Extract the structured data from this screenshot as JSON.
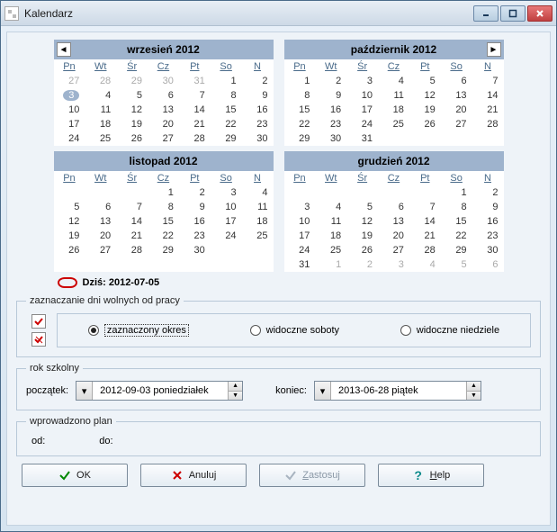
{
  "window": {
    "title": "Kalendarz"
  },
  "nav": {
    "prev": "◄",
    "next": "►"
  },
  "weekdays": [
    "Pn",
    "Wt",
    "Śr",
    "Cz",
    "Pt",
    "So",
    "N"
  ],
  "months": [
    {
      "label": "wrzesień  2012",
      "nav": "prev",
      "selected_row": 1,
      "selected_col": 0,
      "grid": [
        [
          {
            "d": 27,
            "dim": true
          },
          {
            "d": 28,
            "dim": true
          },
          {
            "d": 29,
            "dim": true
          },
          {
            "d": 30,
            "dim": true
          },
          {
            "d": 31,
            "dim": true
          },
          {
            "d": 1
          },
          {
            "d": 2
          }
        ],
        [
          {
            "d": 3
          },
          {
            "d": 4
          },
          {
            "d": 5
          },
          {
            "d": 6
          },
          {
            "d": 7
          },
          {
            "d": 8
          },
          {
            "d": 9
          }
        ],
        [
          {
            "d": 10
          },
          {
            "d": 11
          },
          {
            "d": 12
          },
          {
            "d": 13
          },
          {
            "d": 14
          },
          {
            "d": 15
          },
          {
            "d": 16
          }
        ],
        [
          {
            "d": 17
          },
          {
            "d": 18
          },
          {
            "d": 19
          },
          {
            "d": 20
          },
          {
            "d": 21
          },
          {
            "d": 22
          },
          {
            "d": 23
          }
        ],
        [
          {
            "d": 24
          },
          {
            "d": 25
          },
          {
            "d": 26
          },
          {
            "d": 27
          },
          {
            "d": 28
          },
          {
            "d": 29
          },
          {
            "d": 30
          }
        ]
      ]
    },
    {
      "label": "październik  2012",
      "nav": "next",
      "grid": [
        [
          {
            "d": 1
          },
          {
            "d": 2
          },
          {
            "d": 3
          },
          {
            "d": 4
          },
          {
            "d": 5
          },
          {
            "d": 6
          },
          {
            "d": 7
          }
        ],
        [
          {
            "d": 8
          },
          {
            "d": 9
          },
          {
            "d": 10
          },
          {
            "d": 11
          },
          {
            "d": 12
          },
          {
            "d": 13
          },
          {
            "d": 14
          }
        ],
        [
          {
            "d": 15
          },
          {
            "d": 16
          },
          {
            "d": 17
          },
          {
            "d": 18
          },
          {
            "d": 19
          },
          {
            "d": 20
          },
          {
            "d": 21
          }
        ],
        [
          {
            "d": 22
          },
          {
            "d": 23
          },
          {
            "d": 24
          },
          {
            "d": 25
          },
          {
            "d": 26
          },
          {
            "d": 27
          },
          {
            "d": 28
          }
        ],
        [
          {
            "d": 29
          },
          {
            "d": 30
          },
          {
            "d": 31
          },
          {
            "d": ""
          },
          {
            "d": ""
          },
          {
            "d": ""
          },
          {
            "d": ""
          }
        ]
      ]
    },
    {
      "label": "listopad  2012",
      "grid": [
        [
          {
            "d": ""
          },
          {
            "d": ""
          },
          {
            "d": ""
          },
          {
            "d": 1
          },
          {
            "d": 2
          },
          {
            "d": 3
          },
          {
            "d": 4
          }
        ],
        [
          {
            "d": 5
          },
          {
            "d": 6
          },
          {
            "d": 7
          },
          {
            "d": 8
          },
          {
            "d": 9
          },
          {
            "d": 10
          },
          {
            "d": 11
          }
        ],
        [
          {
            "d": 12
          },
          {
            "d": 13
          },
          {
            "d": 14
          },
          {
            "d": 15
          },
          {
            "d": 16
          },
          {
            "d": 17
          },
          {
            "d": 18
          }
        ],
        [
          {
            "d": 19
          },
          {
            "d": 20
          },
          {
            "d": 21
          },
          {
            "d": 22
          },
          {
            "d": 23
          },
          {
            "d": 24
          },
          {
            "d": 25
          }
        ],
        [
          {
            "d": 26
          },
          {
            "d": 27
          },
          {
            "d": 28
          },
          {
            "d": 29
          },
          {
            "d": 30
          },
          {
            "d": ""
          },
          {
            "d": ""
          }
        ]
      ]
    },
    {
      "label": "grudzień  2012",
      "grid": [
        [
          {
            "d": ""
          },
          {
            "d": ""
          },
          {
            "d": ""
          },
          {
            "d": ""
          },
          {
            "d": ""
          },
          {
            "d": 1
          },
          {
            "d": 2
          }
        ],
        [
          {
            "d": 3
          },
          {
            "d": 4
          },
          {
            "d": 5
          },
          {
            "d": 6
          },
          {
            "d": 7
          },
          {
            "d": 8
          },
          {
            "d": 9
          }
        ],
        [
          {
            "d": 10
          },
          {
            "d": 11
          },
          {
            "d": 12
          },
          {
            "d": 13
          },
          {
            "d": 14
          },
          {
            "d": 15
          },
          {
            "d": 16
          }
        ],
        [
          {
            "d": 17
          },
          {
            "d": 18
          },
          {
            "d": 19
          },
          {
            "d": 20
          },
          {
            "d": 21
          },
          {
            "d": 22
          },
          {
            "d": 23
          }
        ],
        [
          {
            "d": 24
          },
          {
            "d": 25
          },
          {
            "d": 26
          },
          {
            "d": 27
          },
          {
            "d": 28
          },
          {
            "d": 29
          },
          {
            "d": 30
          }
        ],
        [
          {
            "d": 31
          },
          {
            "d": 1,
            "dim": true
          },
          {
            "d": 2,
            "dim": true
          },
          {
            "d": 3,
            "dim": true
          },
          {
            "d": 4,
            "dim": true
          },
          {
            "d": 5,
            "dim": true
          },
          {
            "d": 6,
            "dim": true
          }
        ]
      ]
    }
  ],
  "today": {
    "label": "Dziś: 2012-07-05"
  },
  "group_days": {
    "legend": "zaznaczanie dni wolnych od pracy",
    "options": [
      "zaznaczony okres",
      "widoczne soboty",
      "widoczne niedziele"
    ],
    "selected": 0
  },
  "school_year": {
    "legend": "rok szkolny",
    "start_label": "początek:",
    "start_value": "2012-09-03 poniedziałek",
    "end_label": "koniec:",
    "end_value": "2013-06-28    piątek"
  },
  "plan": {
    "legend": "wprowadzono plan",
    "from_label": "od:",
    "to_label": "do:"
  },
  "buttons": {
    "ok": "OK",
    "cancel": "Anuluj",
    "apply_prefix": "Z",
    "apply_rest": "astosuj",
    "help_prefix": "H",
    "help_rest": "elp"
  }
}
